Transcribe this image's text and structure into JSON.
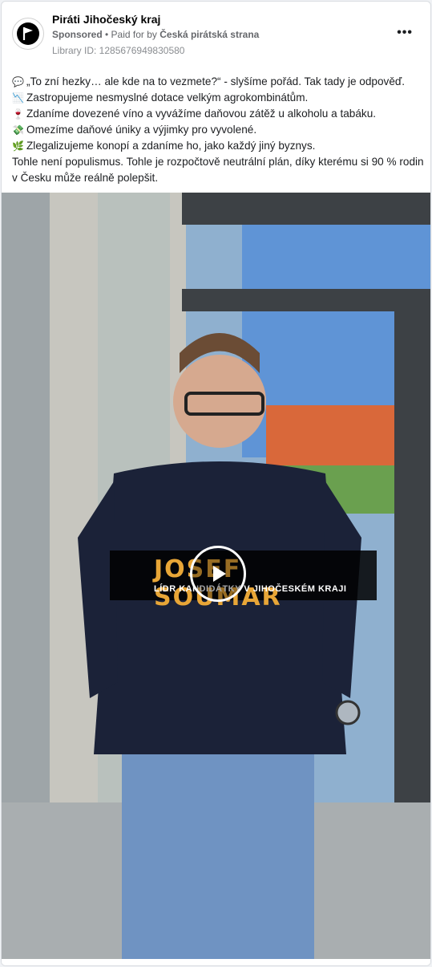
{
  "post": {
    "page_name": "Piráti Jihočeský kraj",
    "sponsored_label": "Sponsored",
    "paid_prefix": " • Paid for by ",
    "paid_by": "Česká pirátská strana",
    "library_id": "Library ID: 1285676949830580",
    "more_label": "•••",
    "avatar_icon": "pirate-flag-icon"
  },
  "text": {
    "lines": [
      {
        "emoji": "💬",
        "emoji_name": "speech-bubble-icon",
        "text": "„To zní hezky… ale kde na to vezmete?“ - slyšíme pořád. Tak tady je odpověď."
      },
      {
        "emoji": "📉",
        "emoji_name": "chart-down-icon",
        "text": "Zastropujeme nesmyslné dotace velkým agrokombinátům."
      },
      {
        "emoji": "🍷",
        "emoji_name": "wine-glass-icon",
        "text": "Zdaníme dovezené víno a vyvážíme daňovou zátěž u alkoholu a tabáku."
      },
      {
        "emoji": "💸",
        "emoji_name": "money-wings-icon",
        "text": "Omezíme daňové úniky a výjimky pro vyvolené."
      },
      {
        "emoji": "🌿",
        "emoji_name": "herb-icon",
        "text": "Zlegalizujeme konopí a zdaníme ho, jako každý jiný byznys."
      }
    ],
    "closing": "Tohle není populismus. Tohle je rozpočtově neutrální plán, díky kterému si 90 % rodin v Česku může reálně polepšit."
  },
  "video": {
    "caption_name": "JOSEF SOUMAR",
    "caption_role": "LÍDR KANDIDÁTKY V JIHOČESKÉM KRAJI",
    "play_icon": "play-icon"
  },
  "colors": {
    "accent": "#e8a637",
    "meta_text": "#65676b"
  }
}
